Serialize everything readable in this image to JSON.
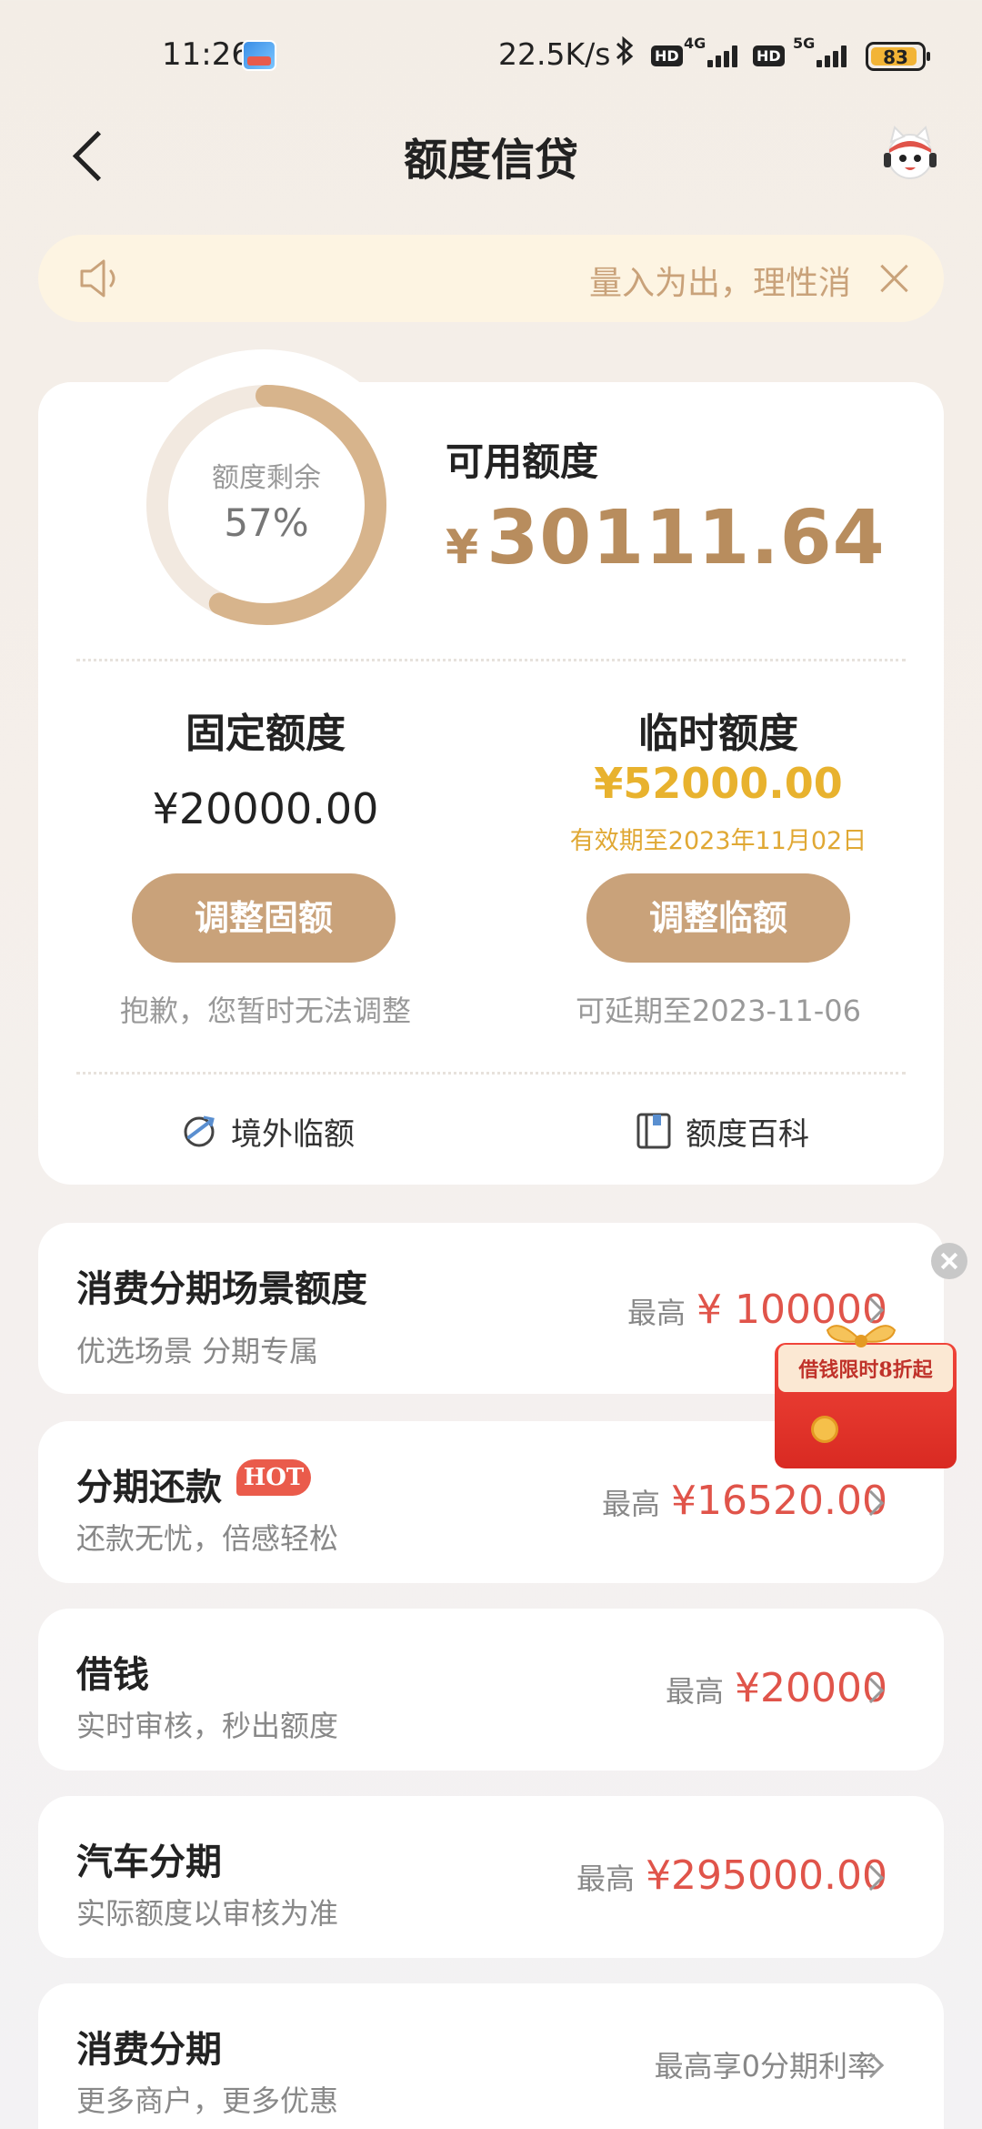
{
  "status_bar": {
    "time": "11:26",
    "net_speed": "22.5K/s",
    "bluetooth": "bluetooth-icon",
    "hd1": "HD",
    "net1": "4G",
    "hd2": "HD",
    "net2": "5G",
    "battery": "83"
  },
  "nav": {
    "title": "额度信贷"
  },
  "notice": {
    "text": "量入为出，理性消"
  },
  "credit": {
    "ring_label": "额度剩余",
    "ring_percent": "57%",
    "ring_fraction": 0.57,
    "available_label": "可用额度",
    "currency": "¥",
    "available_amount": "30111.64",
    "fixed": {
      "title": "固定额度",
      "amount": "¥20000.00",
      "button": "调整固额",
      "note": "抱歉，您暂时无法调整"
    },
    "temporary": {
      "title": "临时额度",
      "amount": "¥52000.00",
      "valid_until": "有效期至2023年11月02日",
      "button": "调整临额",
      "note": "可延期至2023-11-06"
    },
    "links": {
      "overseas": "境外临额",
      "wiki": "额度百科"
    }
  },
  "products": [
    {
      "title": "消费分期场景额度",
      "subtitle": "优选场景 分期专属",
      "prefix": "最高",
      "value": "¥ 100000"
    },
    {
      "title": "分期还款",
      "badge": "HOT",
      "subtitle": "还款无忧，倍感轻松",
      "prefix": "最高",
      "value": "¥16520.00"
    },
    {
      "title": "借钱",
      "subtitle": "实时审核，秒出额度",
      "prefix": "最高",
      "value": "¥20000"
    },
    {
      "title": "汽车分期",
      "subtitle": "实际额度以审核为准",
      "prefix": "最高",
      "value": "¥295000.00"
    },
    {
      "title": "消费分期",
      "subtitle": "更多商户，更多优惠",
      "prefix": "最高享0分期利率",
      "value": ""
    }
  ],
  "promo": {
    "text": "借钱限时8折起"
  },
  "colors": {
    "gold": "#c9a27a",
    "amount_gold": "#b88d5e",
    "temp_yellow": "#e8b22e",
    "red": "#e0544a"
  }
}
